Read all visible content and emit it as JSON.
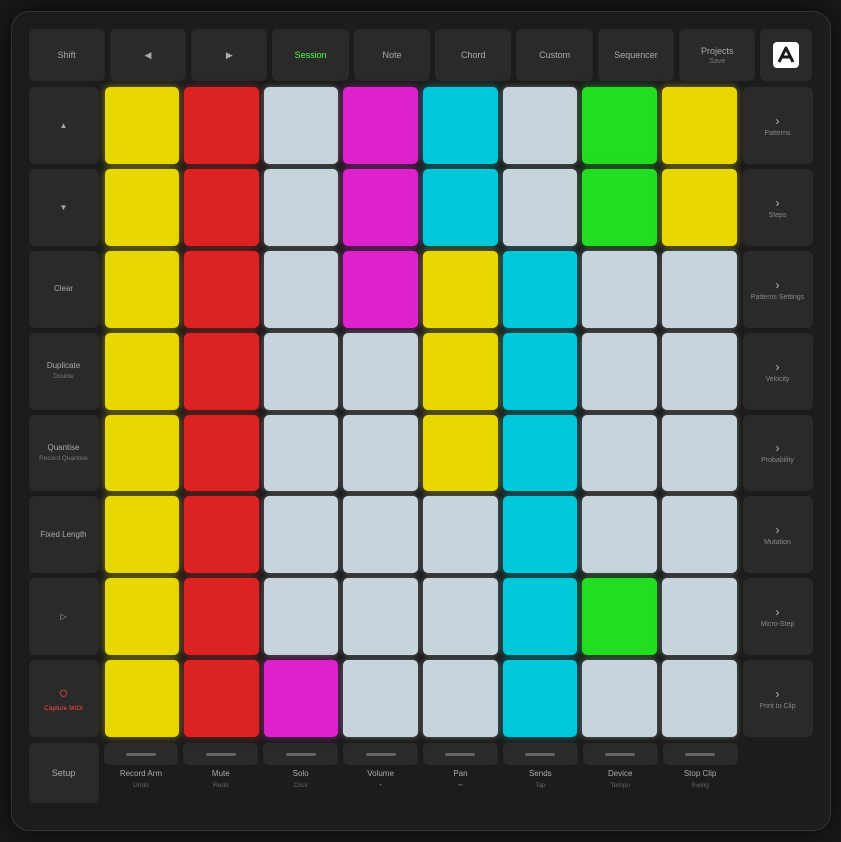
{
  "topRow": {
    "shift": "Shift",
    "back": "◀",
    "forward": "▶",
    "session": "Session",
    "note": "Note",
    "chord": "Chord",
    "custom": "Custom",
    "sequencer": "Sequencer",
    "projects": "Projects",
    "projects_sub": "Save"
  },
  "leftControls": [
    {
      "label": "▲",
      "sub": ""
    },
    {
      "label": "▼",
      "sub": ""
    },
    {
      "label": "Clear",
      "sub": ""
    },
    {
      "label": "Duplicate",
      "sub": "Double"
    },
    {
      "label": "Quantise",
      "sub": "Record Quantise"
    },
    {
      "label": "Fixed Length",
      "sub": ""
    },
    {
      "label": "▷",
      "sub": ""
    },
    {
      "label": "○",
      "sub": "Capture MIDI",
      "cls": "red-circle"
    }
  ],
  "rightControls": [
    {
      "chevron": "›",
      "label": "Patterns"
    },
    {
      "chevron": "›",
      "label": "Steps"
    },
    {
      "chevron": "›",
      "label": "Patterns Settings"
    },
    {
      "chevron": "›",
      "label": "Velocity"
    },
    {
      "chevron": "›",
      "label": "Probability"
    },
    {
      "chevron": "›",
      "label": "Mutation"
    },
    {
      "chevron": "›",
      "label": "Micro-Step"
    },
    {
      "chevron": "›",
      "label": "Print to Clip"
    }
  ],
  "bottomCols": [
    {
      "label": "Record Arm",
      "sub": "Undo"
    },
    {
      "label": "Mute",
      "sub": "Redo"
    },
    {
      "label": "Solo",
      "sub": "Click"
    },
    {
      "label": "Volume",
      "sub": "•"
    },
    {
      "label": "Pan",
      "sub": "••"
    },
    {
      "label": "Sends",
      "sub": "Tap"
    },
    {
      "label": "Device",
      "sub": "Tempo"
    },
    {
      "label": "Stop Clip",
      "sub": "Swing"
    }
  ],
  "setup": "Setup",
  "grid": [
    [
      "yellow",
      "red",
      "white",
      "magenta",
      "cyan",
      "white",
      "green",
      "yellow",
      "white",
      "purple"
    ],
    [
      "yellow",
      "red",
      "white",
      "magenta",
      "cyan",
      "white",
      "green",
      "yellow",
      "white",
      "purple"
    ],
    [
      "yellow",
      "red",
      "white",
      "magenta",
      "cyan",
      "white",
      "white",
      "white",
      "yellow",
      "purple"
    ],
    [
      "yellow",
      "red",
      "white",
      "magenta",
      "yellow",
      "cyan",
      "white",
      "white",
      "yellow",
      "purple"
    ],
    [
      "yellow",
      "red",
      "white",
      "magenta",
      "yellow",
      "cyan",
      "white",
      "white",
      "yellow",
      "purple"
    ],
    [
      "yellow",
      "red",
      "white",
      "white",
      "white",
      "cyan",
      "white",
      "white",
      "yellow",
      "purple"
    ],
    [
      "yellow",
      "red",
      "white",
      "white",
      "white",
      "cyan",
      "green",
      "white",
      "yellow",
      "purple"
    ],
    [
      "yellow",
      "red",
      "magenta",
      "white",
      "white",
      "cyan",
      "white",
      "white",
      "yellow",
      "purple"
    ]
  ],
  "padColors": {
    "yellow": "#e8d800",
    "red": "#dd2222",
    "white": "#d0d8e0",
    "magenta": "#dd22cc",
    "cyan": "#00c8d8",
    "green": "#22dd22",
    "purple": "#8822cc",
    "dark": "#1e2428",
    "orange": "#e87800"
  },
  "specialPads": {
    "r3c5": "#e8d800",
    "r3c6": "#00c8d8",
    "r4c5": "#e8d800",
    "r4c6": "#00c8d8"
  }
}
